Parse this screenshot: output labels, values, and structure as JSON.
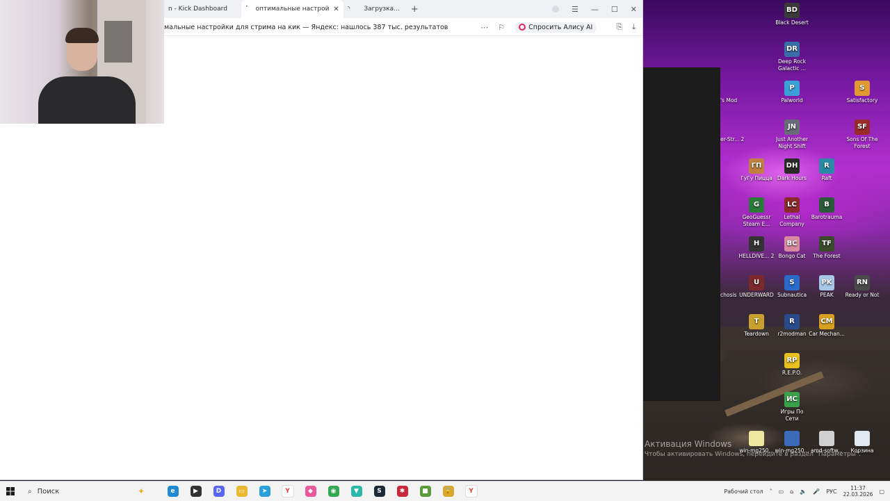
{
  "browser": {
    "tabs": [
      {
        "label": "n - Kick Dashboard",
        "active": false,
        "loading": false
      },
      {
        "label": "оптимальные настрой",
        "active": true,
        "loading": true
      },
      {
        "label": "Загрузка...",
        "active": false,
        "loading": true
      }
    ],
    "address": "мальные настройки для стрима на кик — Яндекс: нашлось 387 тыс. результатов",
    "alice_button": "Спросить Алису AI"
  },
  "desktop": {
    "icons": [
      {
        "label": "Black Desert",
        "color": "#3a3a3a",
        "glyph": "BD"
      },
      {
        "label": "Deep Rock Galactic ...",
        "color": "#3a6ea8",
        "glyph": "DR"
      },
      {
        "label": "Palworld",
        "color": "#3aa0d8",
        "glyph": "P"
      },
      {
        "label": "Satisfactory",
        "color": "#e09a30",
        "glyph": "S"
      },
      {
        "label": "Just Another Night Shift",
        "color": "#6a6a7a",
        "glyph": "JN"
      },
      {
        "label": "Sons Of The Forest",
        "color": "#9a2a2a",
        "glyph": "SF"
      },
      {
        "label": "ГуГу Пицца",
        "color": "#c08040",
        "glyph": "ГП"
      },
      {
        "label": "Dark Hours",
        "color": "#2a2a2a",
        "glyph": "DH"
      },
      {
        "label": "Raft",
        "color": "#2a8aa8",
        "glyph": "R"
      },
      {
        "label": "GeoGuessr Steam E...",
        "color": "#2a7a3a",
        "glyph": "G"
      },
      {
        "label": "Lethal Company",
        "color": "#8a2a2a",
        "glyph": "LC"
      },
      {
        "label": "Barotrauma",
        "color": "#2a5a3a",
        "glyph": "B"
      },
      {
        "label": "HELLDIVE... 2",
        "color": "#333333",
        "glyph": "H"
      },
      {
        "label": "Bongo Cat",
        "color": "#d88aa0",
        "glyph": "BC"
      },
      {
        "label": "The Forest",
        "color": "#3a4a2a",
        "glyph": "TF"
      },
      {
        "label": "UNDERWARD",
        "color": "#7a2a2a",
        "glyph": "U"
      },
      {
        "label": "Subnautica",
        "color": "#2a6ac8",
        "glyph": "S"
      },
      {
        "label": "PEAK",
        "color": "#a8c8e8",
        "glyph": "PK"
      },
      {
        "label": "Ready or Not",
        "color": "#4a4a4a",
        "glyph": "RN"
      },
      {
        "label": "Teardown",
        "color": "#c8a030",
        "glyph": "T"
      },
      {
        "label": "r2modman",
        "color": "#2a4a8a",
        "glyph": "R"
      },
      {
        "label": "Car Mechan...",
        "color": "#d8a020",
        "glyph": "CM"
      },
      {
        "label": "R.E.P.O.",
        "color": "#e8c020",
        "glyph": "RP"
      },
      {
        "label": "Игры По Сети",
        "color": "#3aa04a",
        "glyph": "ИС"
      },
      {
        "label": "win-mg250...",
        "color": "#f0e8a0",
        "glyph": ""
      },
      {
        "label": "win-mg250...",
        "color": "#3a6ab8",
        "glyph": ""
      },
      {
        "label": "amd-softw...",
        "color": "#d0d0d0",
        "glyph": ""
      },
      {
        "label": "Корзина",
        "color": "#e0e8f0",
        "glyph": ""
      }
    ],
    "partial_icons": [
      {
        "label": "'s Mod"
      },
      {
        "label": "er-Str... 2"
      },
      {
        "label": "chosis"
      }
    ],
    "activation_title": "Активация Windows",
    "activation_sub": "Чтобы активировать Windows, перейдите в раздел \"Параметры\"."
  },
  "taskbar": {
    "search_label": "Поиск",
    "apps": [
      {
        "name": "edge-icon",
        "color": "#1f8ad2",
        "glyph": "e"
      },
      {
        "name": "player-icon",
        "color": "#333333",
        "glyph": "▶"
      },
      {
        "name": "discord-icon",
        "color": "#5865f2",
        "glyph": "D"
      },
      {
        "name": "folder-icon",
        "color": "#e8b830",
        "glyph": "▭"
      },
      {
        "name": "telegram-icon",
        "color": "#2aa0da",
        "glyph": "➤"
      },
      {
        "name": "yandex-icon",
        "color": "#ffffff",
        "glyph": "Y"
      },
      {
        "name": "app-icon-1",
        "color": "#e85a9a",
        "glyph": "◆"
      },
      {
        "name": "chrome-icon",
        "color": "#34a853",
        "glyph": "◉"
      },
      {
        "name": "vpn-icon",
        "color": "#2ab8a8",
        "glyph": "▼"
      },
      {
        "name": "steam-icon",
        "color": "#1b2838",
        "glyph": "S"
      },
      {
        "name": "app-icon-2",
        "color": "#c8283a",
        "glyph": "✱"
      },
      {
        "name": "minecraft-icon",
        "color": "#5a9a3a",
        "glyph": "■"
      },
      {
        "name": "lock-app-icon",
        "color": "#d8a830",
        "glyph": "🔒"
      },
      {
        "name": "yandex-browser-icon",
        "color": "#ffffff",
        "glyph": "Y"
      }
    ],
    "desktop_label": "Рабочий стол",
    "lang": "РУС",
    "time": "11:37",
    "date": "22.03.2026"
  }
}
